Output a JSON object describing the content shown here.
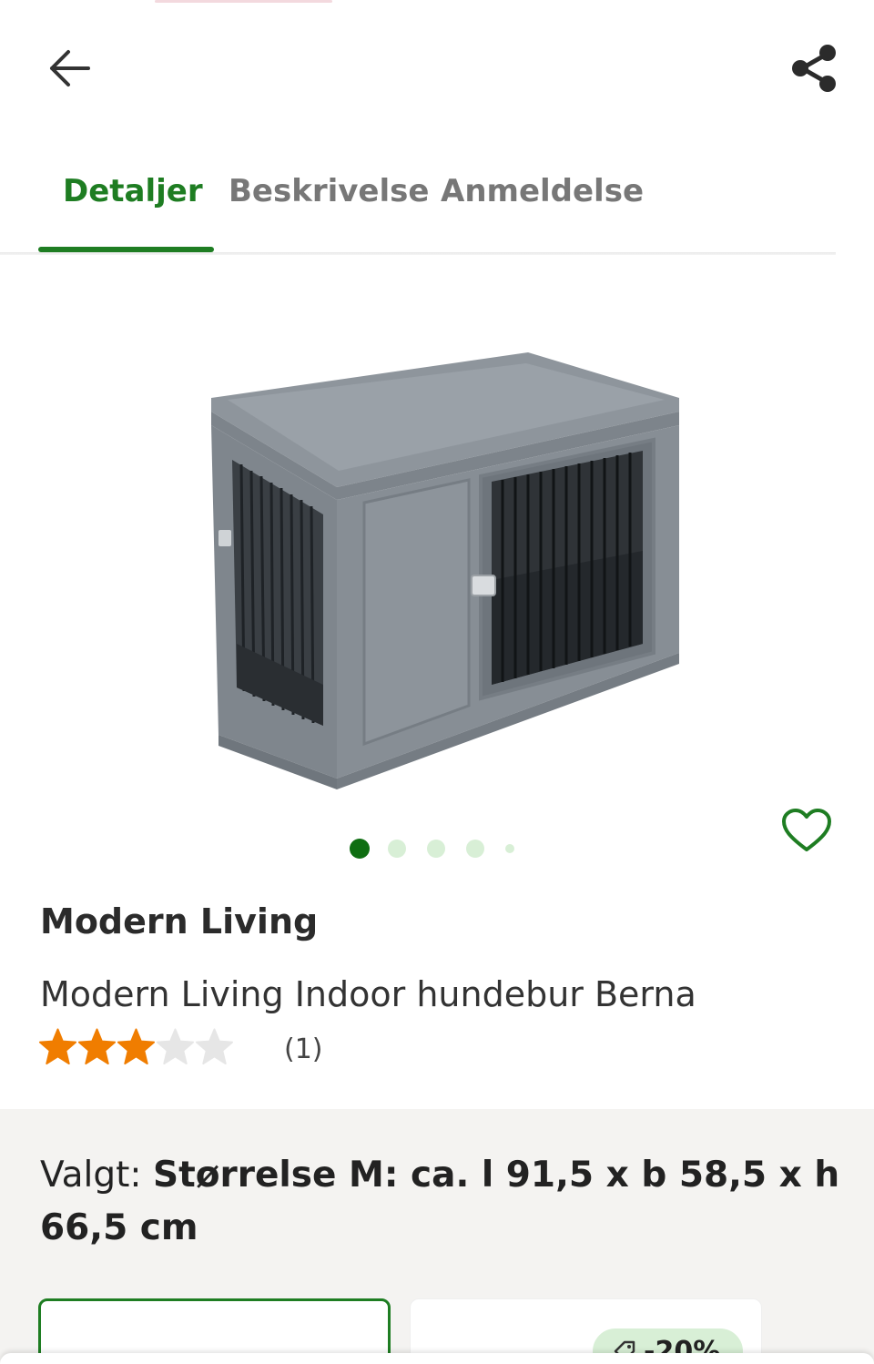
{
  "colors": {
    "accent": "#1e7d22",
    "tab_inactive": "#777777",
    "star_filled": "#f07d00",
    "star_empty": "#e6e6e6",
    "dot_active": "#0f6e12",
    "dot_inactive": "#d8efd6",
    "variant_bg": "#f4f3f1"
  },
  "header": {
    "back_icon": "arrow-left-icon",
    "share_icon": "share-icon"
  },
  "tabs": [
    {
      "label": "Detaljer",
      "active": true
    },
    {
      "label": "Beskrivelse",
      "active": false
    },
    {
      "label": "Anmeldelse",
      "active": false
    }
  ],
  "gallery": {
    "image_alt": "dog-crate-product-image",
    "image_count": 5,
    "active_index": 0,
    "favorite_icon": "heart-outline-icon"
  },
  "product": {
    "brand": "Modern Living",
    "title": "Modern Living Indoor hundebur Berna",
    "rating": 3,
    "rating_max": 5,
    "review_count": "(1)"
  },
  "variant": {
    "prefix": "Valgt: ",
    "selected": "Størrelse M: ca. l 91,5 x b 58,5 x h 66,5 cm",
    "discount_badge": "-20%"
  }
}
